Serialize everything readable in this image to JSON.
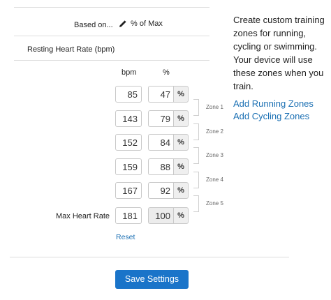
{
  "form": {
    "based_on_label": "Based on...",
    "based_on_value": "% of Max",
    "resting_label": "Resting Heart Rate (bpm)",
    "col_bpm": "bpm",
    "col_pct": "%",
    "rows": [
      {
        "bpm": "85",
        "pct": "47",
        "unit": "%"
      },
      {
        "bpm": "143",
        "pct": "79",
        "unit": "%"
      },
      {
        "bpm": "152",
        "pct": "84",
        "unit": "%"
      },
      {
        "bpm": "159",
        "pct": "88",
        "unit": "%"
      },
      {
        "bpm": "167",
        "pct": "92",
        "unit": "%"
      }
    ],
    "max": {
      "label": "Max Heart Rate",
      "bpm": "181",
      "pct": "100",
      "unit": "%"
    },
    "zones": [
      "Zone 1",
      "Zone 2",
      "Zone 3",
      "Zone 4",
      "Zone 5"
    ],
    "reset": "Reset",
    "save": "Save Settings"
  },
  "side": {
    "description": "Create custom training zones for running, cycling or swimming. Your device will use these zones when you train.",
    "link_running": "Add Running Zones",
    "link_cycling": "Add Cycling Zones"
  },
  "icons": {
    "edit": "pencil-icon"
  },
  "colors": {
    "link": "#1a6fb3",
    "button": "#1a74c9"
  }
}
